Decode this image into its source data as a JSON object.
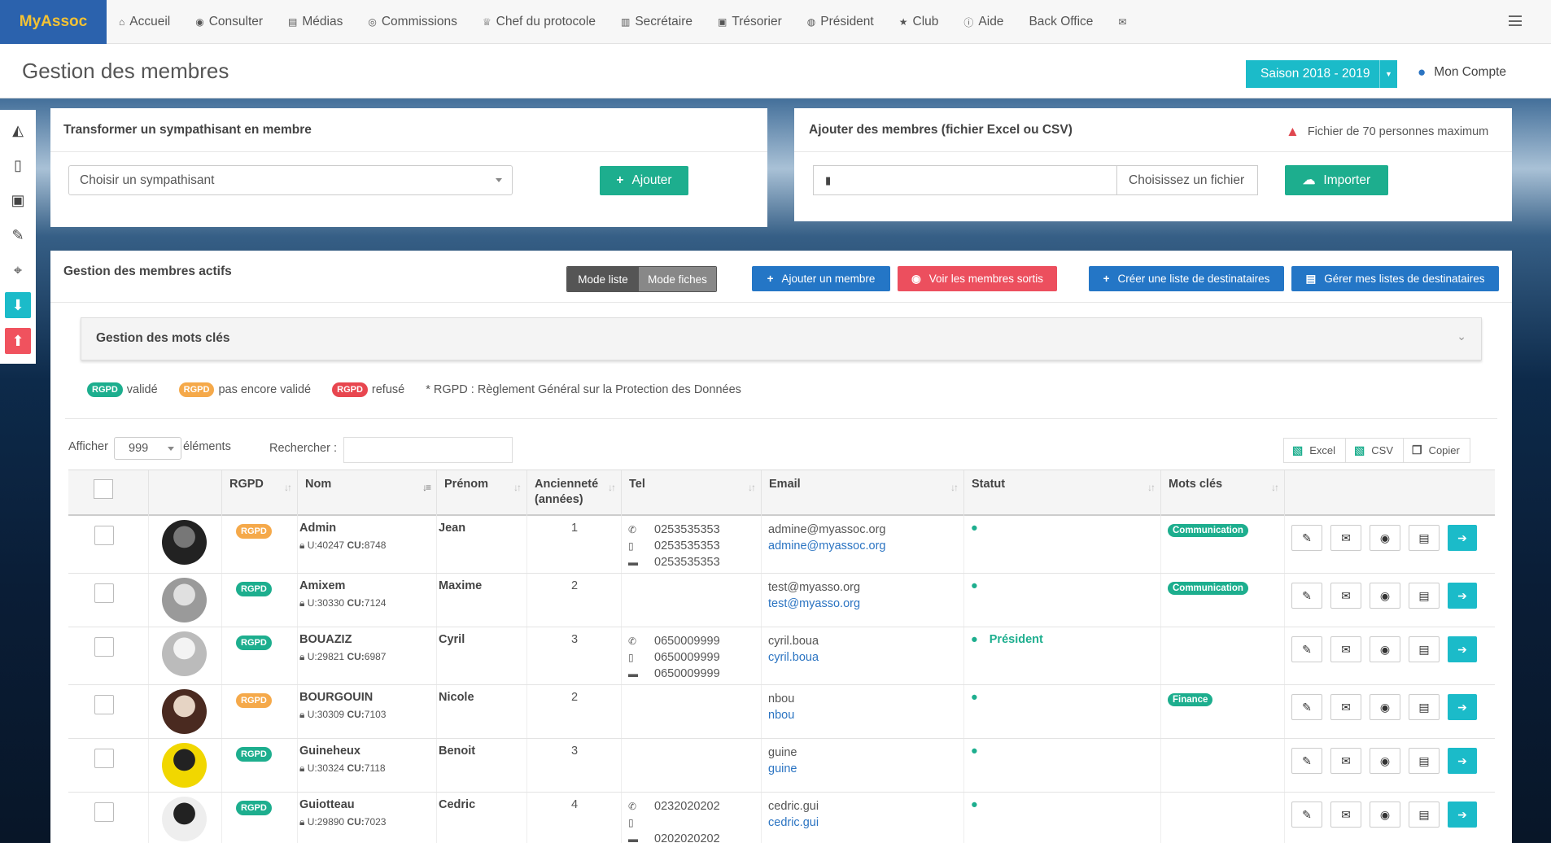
{
  "nav": {
    "brand": "MyAssoc",
    "items": [
      {
        "label": "Accueil",
        "icon": "home-icon",
        "glyph": "⌂"
      },
      {
        "label": "Consulter",
        "icon": "eye-icon",
        "glyph": "◉"
      },
      {
        "label": "Médias",
        "icon": "file-icon",
        "glyph": "▤"
      },
      {
        "label": "Commissions",
        "icon": "users-icon",
        "glyph": "◎"
      },
      {
        "label": "Chef du protocole",
        "icon": "trophy-icon",
        "glyph": "♕"
      },
      {
        "label": "Secrétaire",
        "icon": "book-icon",
        "glyph": "▥"
      },
      {
        "label": "Trésorier",
        "icon": "money-icon",
        "glyph": "▣"
      },
      {
        "label": "Président",
        "icon": "globe-icon",
        "glyph": "◍"
      },
      {
        "label": "Club",
        "icon": "star-icon",
        "glyph": "★"
      },
      {
        "label": "Aide",
        "icon": "info-icon",
        "glyph": "ⓘ"
      },
      {
        "label": "Back Office",
        "icon": "",
        "glyph": ""
      },
      {
        "label": "",
        "icon": "envelope-icon",
        "glyph": "✉"
      }
    ]
  },
  "header": {
    "title": "Gestion des membres",
    "season": "Saison 2018 - 2019",
    "account": "Mon Compte"
  },
  "transform": {
    "title": "Transformer un sympathisant en membre",
    "placeholder": "Choisir un sympathisant",
    "button": "Ajouter"
  },
  "import": {
    "title": "Ajouter des membres (fichier Excel ou CSV)",
    "warning": "Fichier de 70 personnes maximum",
    "choose": "Choisissez un fichier",
    "button": "Importer"
  },
  "actifs": {
    "title": "Gestion des membres actifs",
    "mode_list": "Mode liste",
    "mode_cards": "Mode fiches",
    "add_member": "Ajouter un membre",
    "show_left": "Voir les membres sortis",
    "create_list": "Créer une liste de destinataires",
    "manage_lists": "Gérer mes listes de destinataires",
    "keywords": "Gestion des mots clés"
  },
  "legend": {
    "badge": "RGPD",
    "valid": "validé",
    "pending": "pas encore validé",
    "refused": "refusé",
    "note": "* RGPD : Règlement Général sur la Protection des Données"
  },
  "controls": {
    "show": "Afficher",
    "count": "999",
    "elements": "éléments",
    "search": "Rechercher :",
    "excel": "Excel",
    "csv": "CSV",
    "copy": "Copier"
  },
  "columns": {
    "rgpd": "RGPD",
    "nom": "Nom",
    "prenom": "Prénom",
    "anc1": "Ancienneté",
    "anc2": "(années)",
    "tel": "Tel",
    "email": "Email",
    "statut": "Statut",
    "mots": "Mots clés"
  },
  "colors": {
    "green": "#1dae8e",
    "orange": "#f5a94a",
    "red": "#e8464f",
    "blue": "#2476c6",
    "cyan": "#1bbbc9"
  },
  "rows": [
    {
      "nom": "Admin",
      "u": "40247",
      "cu": "8748",
      "prenom": "Jean",
      "anc": "1",
      "rgpd": "pending",
      "tels": [
        "0253535353",
        "0253535353",
        "0253535353"
      ],
      "email1": "admine@myassoc.org",
      "email2": "admine@myassoc.org",
      "statut": "",
      "mot": "Communication"
    },
    {
      "nom": "Amixem",
      "u": "30330",
      "cu": "7124",
      "prenom": "Maxime",
      "anc": "2",
      "rgpd": "valid",
      "tels": [],
      "email1": "test@myasso.org",
      "email2": "test@myasso.org",
      "statut": "",
      "mot": "Communication"
    },
    {
      "nom": "BOUAZIZ",
      "u": "29821",
      "cu": "6987",
      "prenom": "Cyril",
      "anc": "3",
      "rgpd": "valid",
      "tels": [
        "0650009999",
        "0650009999",
        "0650009999"
      ],
      "email1": "cyril.boua",
      "email2": "cyril.boua",
      "statut": "Président",
      "mot": ""
    },
    {
      "nom": "BOURGOUIN",
      "u": "30309",
      "cu": "7103",
      "prenom": "Nicole",
      "anc": "2",
      "rgpd": "pending",
      "tels": [],
      "email1": "nbou",
      "email2": "nbou",
      "statut": "",
      "mot": "Finance"
    },
    {
      "nom": "Guineheux",
      "u": "30324",
      "cu": "7118",
      "prenom": "Benoit",
      "anc": "3",
      "rgpd": "valid",
      "tels": [],
      "email1": "guine",
      "email2": "guine",
      "statut": "",
      "mot": ""
    },
    {
      "nom": "Guiotteau",
      "u": "29890",
      "cu": "7023",
      "prenom": "Cedric",
      "anc": "4",
      "rgpd": "valid",
      "tels": [
        "0232020202",
        "",
        "0202020202"
      ],
      "email1": "cedric.gui",
      "email2": "cedric.gui",
      "statut": "",
      "mot": ""
    }
  ]
}
